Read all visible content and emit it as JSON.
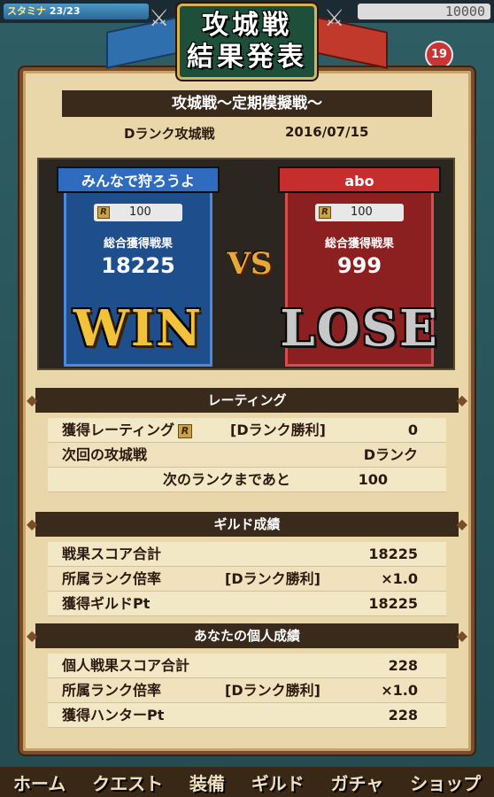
{
  "status": {
    "stamina_label": "スタミナ",
    "stamina_value": "23/23",
    "gold": "10000",
    "notification_count": "19"
  },
  "header": {
    "title_line1": "攻城戦",
    "title_line2": "結果発表"
  },
  "battle": {
    "name": "攻城戦〜定期模擬戦〜",
    "rank": "Dランク攻城戦",
    "date": "2016/07/15"
  },
  "teams": [
    {
      "name": "みんなで狩ろうよ",
      "rating": "100",
      "score_label": "総合獲得戦果",
      "score": "18225",
      "result": "WIN"
    },
    {
      "name": "abo",
      "rating": "100",
      "score_label": "総合獲得戦果",
      "score": "999",
      "result": "LOSE"
    }
  ],
  "vs_label": "VS",
  "rating_section": {
    "title": "レーティング",
    "rows": [
      {
        "label": "獲得レーティング",
        "tag": "[Dランク勝利]",
        "value": "0"
      },
      {
        "label": "次回の攻城戦",
        "tag": "",
        "value": "Dランク"
      },
      {
        "label": "次のランクまであと",
        "tag": "",
        "value": "100"
      }
    ]
  },
  "guild_section": {
    "title": "ギルド成績",
    "rows": [
      {
        "label": "戦果スコア合計",
        "tag": "",
        "value": "18225"
      },
      {
        "label": "所属ランク倍率",
        "tag": "[Dランク勝利]",
        "value": "×1.0"
      },
      {
        "label": "獲得ギルドPt",
        "tag": "",
        "value": "18225"
      }
    ]
  },
  "personal_section": {
    "title": "あなたの個人成績",
    "rows": [
      {
        "label": "個人戦果スコア合計",
        "tag": "",
        "value": "228"
      },
      {
        "label": "所属ランク倍率",
        "tag": "[Dランク勝利]",
        "value": "×1.0"
      },
      {
        "label": "獲得ハンターPt",
        "tag": "",
        "value": "228"
      }
    ]
  },
  "nav": {
    "home": "ホーム",
    "quest": "クエスト",
    "equip": "装備",
    "guild": "ギルド",
    "gacha": "ガチャ",
    "shop": "ショップ"
  },
  "colors": {
    "blue_team": "#1f4e8c",
    "red_team": "#8c1f1f",
    "win_gold": "#f2c23a",
    "panel_bg": "#e9d6a9"
  }
}
